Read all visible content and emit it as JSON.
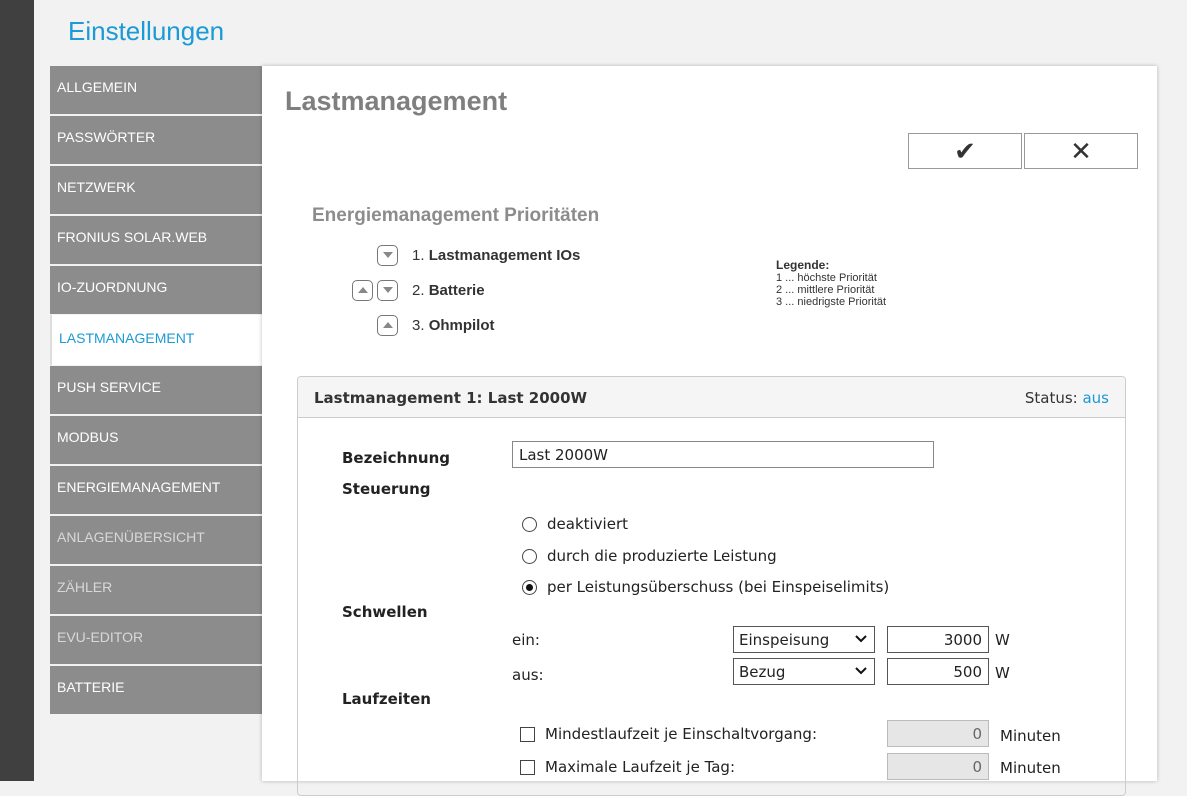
{
  "app": {
    "title": "Einstellungen"
  },
  "nav": [
    {
      "label": "ALLGEMEIN",
      "state": "normal"
    },
    {
      "label": "PASSWÖRTER",
      "state": "normal"
    },
    {
      "label": "NETZWERK",
      "state": "normal"
    },
    {
      "label": "FRONIUS SOLAR.WEB",
      "state": "normal"
    },
    {
      "label": "IO-ZUORDNUNG",
      "state": "normal"
    },
    {
      "label": "LASTMANAGEMENT",
      "state": "active"
    },
    {
      "label": "PUSH SERVICE",
      "state": "normal"
    },
    {
      "label": "MODBUS",
      "state": "normal"
    },
    {
      "label": "ENERGIEMANAGEMENT",
      "state": "normal"
    },
    {
      "label": "ANLAGENÜBERSICHT",
      "state": "dim"
    },
    {
      "label": "ZÄHLER",
      "state": "dim"
    },
    {
      "label": "EVU-EDITOR",
      "state": "dim"
    },
    {
      "label": "BATTERIE",
      "state": "normal"
    }
  ],
  "page": {
    "title": "Lastmanagement",
    "ok_icon": "✔",
    "cancel_icon": "✕"
  },
  "priorities": {
    "title": "Energiemanagement Prioritäten",
    "items": [
      {
        "num": "1.",
        "label": "Lastmanagement IOs",
        "up": false,
        "down": true
      },
      {
        "num": "2.",
        "label": "Batterie",
        "up": true,
        "down": true
      },
      {
        "num": "3.",
        "label": "Ohmpilot",
        "up": true,
        "down": false
      }
    ],
    "legend": {
      "title": "Legende:",
      "lines": [
        "1 ... höchste Priorität",
        "2 ... mittlere Priorität",
        "3 ... niedrigste Priorität"
      ]
    }
  },
  "card": {
    "title": "Lastmanagement 1: Last 2000W",
    "status_label": "Status:",
    "status_value": "aus",
    "bezeichnung_label": "Bezeichnung",
    "bezeichnung_value": "Last 2000W",
    "steuerung_label": "Steuerung",
    "steuerung_options": [
      {
        "label": "deaktiviert",
        "selected": false
      },
      {
        "label": "durch die produzierte Leistung",
        "selected": false
      },
      {
        "label": "per Leistungsüberschuss (bei Einspeiselimits)",
        "selected": true
      }
    ],
    "schwellen_label": "Schwellen",
    "schwellen": [
      {
        "label": "ein:",
        "mode": "Einspeisung",
        "value": "3000",
        "unit": "W"
      },
      {
        "label": "aus:",
        "mode": "Bezug",
        "value": "500",
        "unit": "W"
      }
    ],
    "laufzeiten_label": "Laufzeiten",
    "laufzeiten": [
      {
        "label": "Mindestlaufzeit je Einschaltvorgang:",
        "value": "0",
        "unit": "Minuten",
        "checked": false
      },
      {
        "label": "Maximale Laufzeit je Tag:",
        "value": "0",
        "unit": "Minuten",
        "checked": false
      }
    ]
  }
}
